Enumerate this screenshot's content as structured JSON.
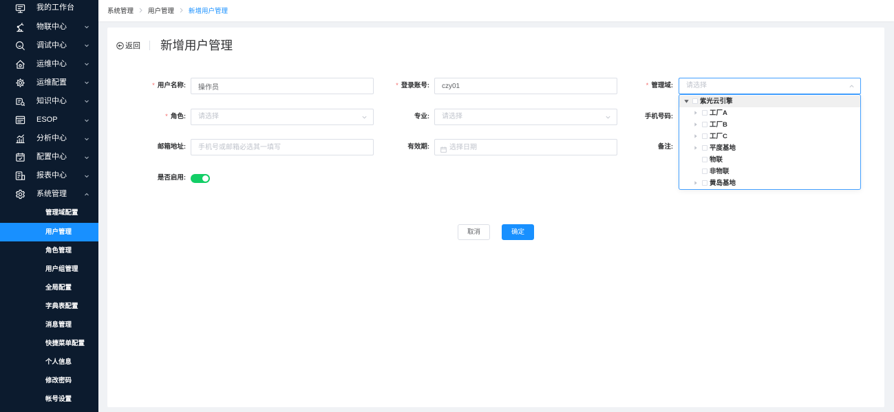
{
  "colors": {
    "sidebar_background": "#0c1b2e",
    "primary": "#1890ff",
    "focus_border": "#409eff",
    "switch_on": "#13ce66",
    "required_mark": "#f56c6c",
    "page_background": "#f0f2f5"
  },
  "sidebar": {
    "items": [
      {
        "label": "我的工作台",
        "icon": "monitor-icon"
      },
      {
        "label": "物联中心",
        "icon": "robot-arm-icon",
        "expanded": false
      },
      {
        "label": "调试中心",
        "icon": "debug-search-icon",
        "expanded": false
      },
      {
        "label": "运维中心",
        "icon": "house-icon",
        "expanded": false
      },
      {
        "label": "运维配置",
        "icon": "gear-icon",
        "expanded": false
      },
      {
        "label": "知识中心",
        "icon": "knowledge-book-icon",
        "expanded": false
      },
      {
        "label": "ESOP",
        "icon": "esop-icon",
        "expanded": false
      },
      {
        "label": "分析中心",
        "icon": "bar-chart-icon",
        "expanded": false
      },
      {
        "label": "配置中心",
        "icon": "config-calendar-icon",
        "expanded": false
      },
      {
        "label": "报表中心",
        "icon": "report-icon",
        "expanded": false
      },
      {
        "label": "系统管理",
        "icon": "settings-gear-icon",
        "expanded": true,
        "children": [
          {
            "label": "管理域配置"
          },
          {
            "label": "用户管理",
            "active": true
          },
          {
            "label": "角色管理"
          },
          {
            "label": "用户组管理"
          },
          {
            "label": "全局配置"
          },
          {
            "label": "字典表配置"
          },
          {
            "label": "消息管理"
          },
          {
            "label": "快捷菜单配置"
          },
          {
            "label": "个人信息"
          },
          {
            "label": "修改密码"
          },
          {
            "label": "帐号设置"
          }
        ]
      }
    ]
  },
  "breadcrumb": {
    "items": [
      {
        "label": "系统管理"
      },
      {
        "label": "用户管理"
      },
      {
        "label": "新增用户管理",
        "current": true
      }
    ]
  },
  "page": {
    "back_label": "返回",
    "back_icon": "arrow-circle-left-icon",
    "title": "新增用户管理"
  },
  "form": {
    "required_mark": "*",
    "username": {
      "label": "用户名称:",
      "required": true,
      "value": "操作员"
    },
    "login_account": {
      "label": "登录账号:",
      "required": true,
      "value": "czy01"
    },
    "management_domain": {
      "label": "管理域:",
      "required": true,
      "placeholder": "请选择",
      "open": true
    },
    "role": {
      "label": "角色:",
      "required": true,
      "placeholder": "请选择"
    },
    "specialty": {
      "label": "专业:",
      "required": false,
      "placeholder": "请选择"
    },
    "phone": {
      "label": "手机号码:",
      "required": false
    },
    "email": {
      "label": "邮箱地址:",
      "required": false,
      "placeholder": "手机号或邮箱必选其一填写"
    },
    "validity": {
      "label": "有效期:",
      "required": false,
      "placeholder": "选择日期",
      "icon": "calendar-icon"
    },
    "remark": {
      "label": "备注:",
      "required": false
    },
    "enabled": {
      "label": "是否启用:",
      "value": true
    }
  },
  "actions": {
    "cancel_label": "取消",
    "confirm_label": "确定"
  },
  "domain_tree": {
    "nodes": [
      {
        "label": "紫光云引擎",
        "expanded": true,
        "highlighted": true,
        "checked": false,
        "children": [
          {
            "label": "工厂A",
            "has_children": true,
            "checked": false
          },
          {
            "label": "工厂B",
            "has_children": true,
            "checked": false
          },
          {
            "label": "工厂C",
            "has_children": true,
            "checked": false
          },
          {
            "label": "平度基地",
            "has_children": true,
            "checked": false
          },
          {
            "label": "物联",
            "has_children": false,
            "checked": false
          },
          {
            "label": "非物联",
            "has_children": false,
            "checked": false
          },
          {
            "label": "黄岛基地",
            "has_children": true,
            "checked": false
          }
        ]
      }
    ]
  }
}
